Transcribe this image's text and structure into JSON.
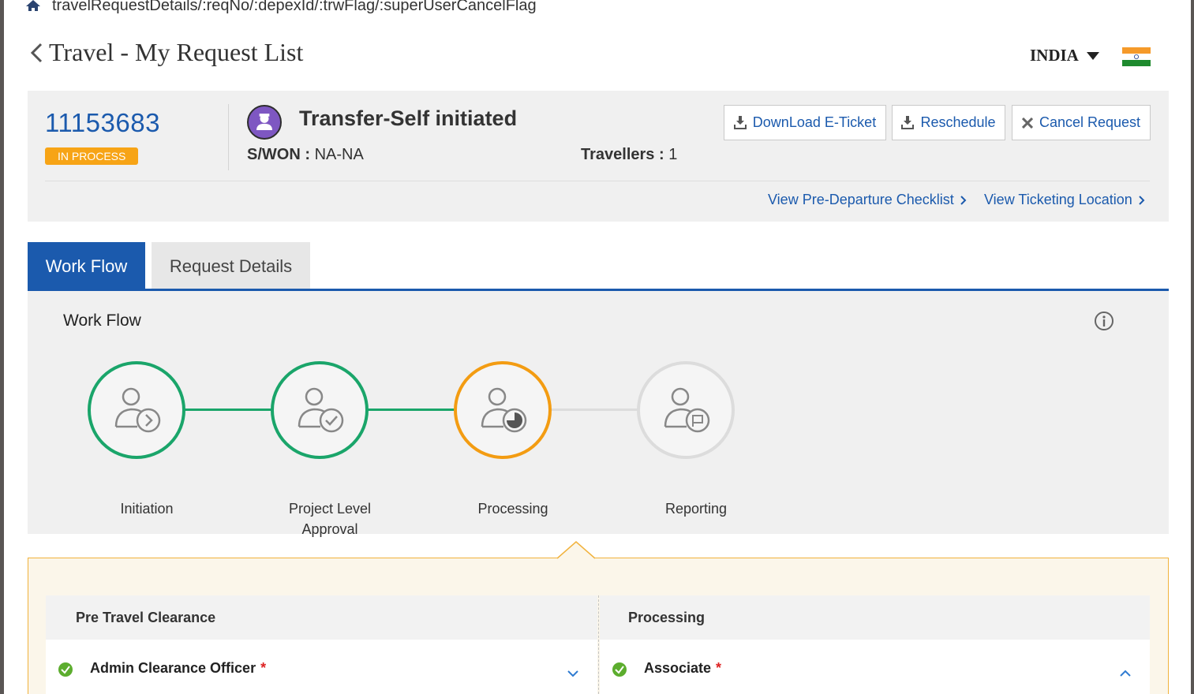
{
  "url_bar": {
    "path": "travelRequestDetails/:reqNo/:depexId/:trwFlag/:superUserCancelFlag"
  },
  "header": {
    "title": "Travel - My Request List",
    "country": "INDIA"
  },
  "request": {
    "number": "11153683",
    "status": "IN PROCESS",
    "type": "Transfer-Self initiated",
    "swon_label": "S/WON :",
    "swon_value": "NA-NA",
    "travellers_label": "Travellers :",
    "travellers_value": "1"
  },
  "actions": {
    "download": "DownLoad E-Ticket",
    "reschedule": "Reschedule",
    "cancel": "Cancel Request"
  },
  "links": {
    "checklist": "View Pre-Departure Checklist",
    "ticketing": "View Ticketing Location"
  },
  "tabs": [
    {
      "label": "Work Flow",
      "active": true
    },
    {
      "label": "Request Details",
      "active": false
    }
  ],
  "workflow": {
    "title": "Work Flow",
    "steps": [
      {
        "label": "Initiation",
        "state": "completed",
        "icon": "user-arrow-icon"
      },
      {
        "label": "Project Level Approval",
        "state": "completed",
        "icon": "user-check-icon"
      },
      {
        "label": "Processing",
        "state": "in-progress",
        "icon": "user-clock-icon"
      },
      {
        "label": "Reporting",
        "state": "pending",
        "icon": "user-flag-icon"
      }
    ]
  },
  "details": {
    "columns": [
      {
        "title": "Pre Travel Clearance",
        "row_label": "Admin Clearance Officer",
        "required": "*",
        "expanded": false
      },
      {
        "title": "Processing",
        "row_label": "Associate",
        "required": "*",
        "expanded": true
      }
    ]
  },
  "colors": {
    "primary": "#1b5aad",
    "completed": "#1aa56a",
    "in_progress": "#f39c12",
    "pending": "#dcdcdc",
    "badge": "#f7a416"
  }
}
